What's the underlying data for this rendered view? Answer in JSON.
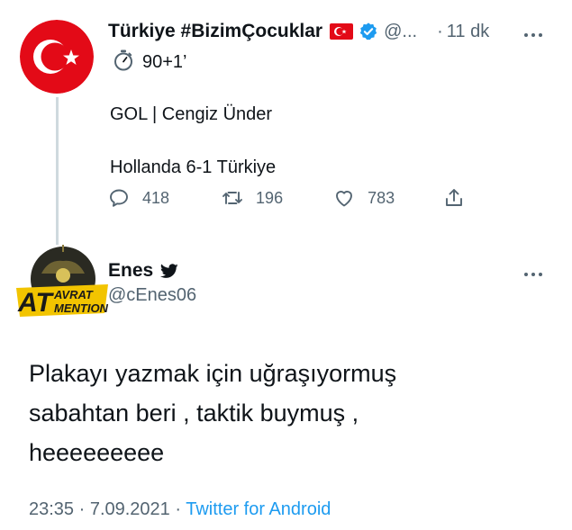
{
  "parent_tweet": {
    "display_name": "Türkiye #BizimÇocuklar",
    "handle": "@...",
    "separator": "·",
    "time": "11 dk",
    "lines": [
      "90+1’",
      "GOL | Cengiz Ünder",
      "Hollanda 6-1 Türkiye"
    ],
    "stats": {
      "replies": "418",
      "retweets": "196",
      "likes": "783"
    }
  },
  "reply_tweet": {
    "display_name": "Enes",
    "handle": "@cEnes06",
    "avatar_text": [
      "AT",
      "AVRAT",
      "MENTION"
    ],
    "text_lines": [
      "Plakayı yazmak için uğraşıyormuş",
      "sabahtan beri , taktik buymuş ,",
      "heeeeeeeee"
    ],
    "timestamp": "23:35 · 7.09.2021",
    "separator": " · ",
    "source": "Twitter for Android"
  },
  "colors": {
    "text": "#0f1419",
    "secondary": "#536471",
    "accent": "#1d9bf0",
    "flag_red": "#e30a17",
    "thread_line": "#cfd9de"
  },
  "icons": [
    "verified-badge-icon",
    "turkey-flag-icon",
    "stopwatch-icon",
    "reply-icon",
    "retweet-icon",
    "like-icon",
    "share-icon",
    "more-icon",
    "twitter-bird-icon"
  ]
}
